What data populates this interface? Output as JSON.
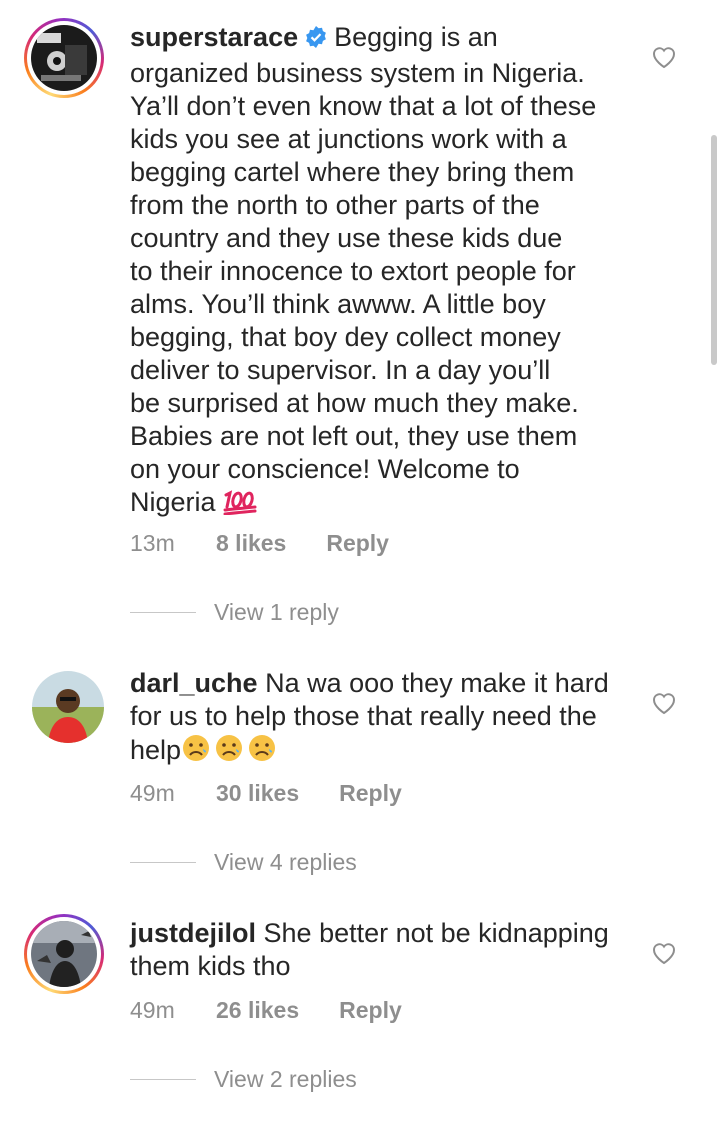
{
  "comments": [
    {
      "username": "superstarace",
      "verified": true,
      "text": "Begging is an\norganized business system in Nigeria.\nYa’ll don’t even know that a lot of these\nkids you see at junctions work with a\nbegging cartel where they bring them\nfrom the north to other parts of the\ncountry and they use these kids due\nto their innocence to extort people for\nalms. You’ll think awww. A little boy\nbegging, that boy dey collect money\ndeliver to supervisor. In a day you’ll\nbe surprised at how much they make.\nBabies are not left out, they use them\non your conscience! Welcome to\nNigeria",
      "emoji": "100-emoji",
      "time": "13m",
      "likes": "8 likes",
      "reply": "Reply",
      "view_replies": "View 1 reply"
    },
    {
      "username": "darl_uche",
      "verified": false,
      "text": "Na wa ooo they make it hard\nfor us to help those that really need the\nhelp",
      "emoji": "sad-face-emoji x3",
      "time": "49m",
      "likes": "30 likes",
      "reply": "Reply",
      "view_replies": "View 4 replies"
    },
    {
      "username": "justdejilol",
      "verified": false,
      "text": "She better not be kidnapping\nthem kids tho",
      "time": "49m",
      "likes": "26 likes",
      "reply": "Reply",
      "view_replies": "View 2 replies"
    }
  ],
  "colors": {
    "text": "#262626",
    "meta": "#8e8e8e",
    "verified_blue": "#3897f0",
    "emoji_red": "#e0245e"
  },
  "icons": [
    "heart-icon",
    "verified-badge-icon"
  ]
}
